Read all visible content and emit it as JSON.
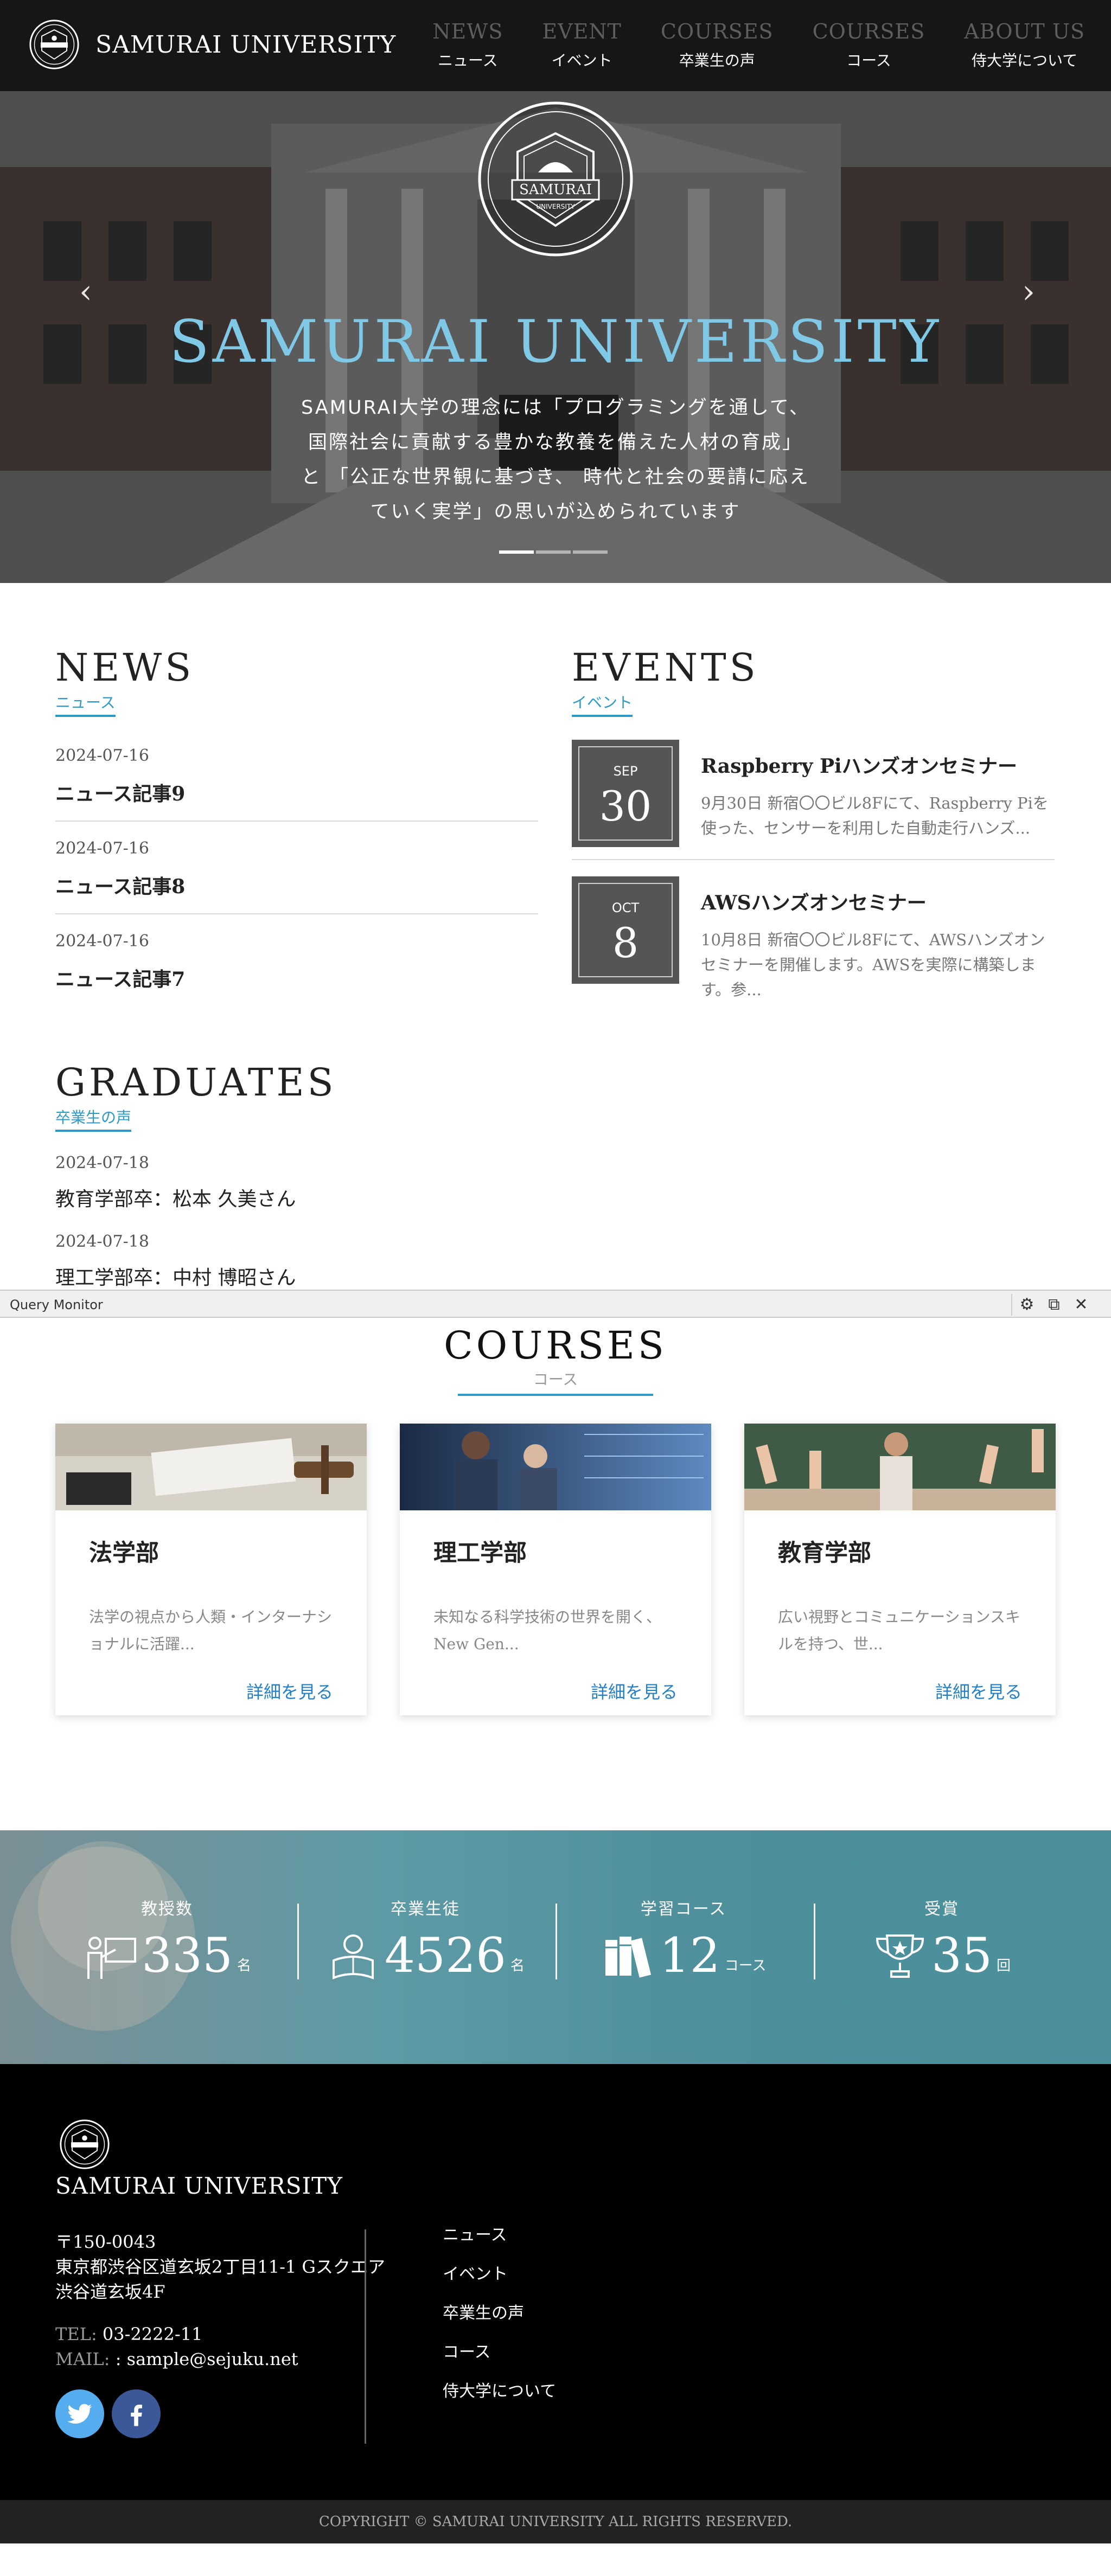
{
  "header": {
    "site_title": "SAMURAI UNIVERSITY",
    "emblem_text": "SAMURAI",
    "nav": [
      {
        "en": "NEWS",
        "ja": "ニュース"
      },
      {
        "en": "EVENT",
        "ja": "イベント"
      },
      {
        "en": "COURSES",
        "ja": "卒業生の声"
      },
      {
        "en": "COURSES",
        "ja": "コース"
      },
      {
        "en": "ABOUT US",
        "ja": "侍大学について"
      }
    ]
  },
  "hero": {
    "emblem_text": "SAMURAI",
    "emblem_sub": "UNIVERSITY",
    "title": "SAMURAI UNIVERSITY",
    "lines": [
      "SAMURAI大学の理念には「プログラミングを通して、",
      "国際社会に貢献する豊かな教養を備えた人材の育成」",
      "と 「公正な世界観に基づき、 時代と社会の要請に応え",
      "ていく実学」の思いが込められています"
    ],
    "prev_icon": "chevron-left-icon",
    "next_icon": "chevron-right-icon",
    "slides": 3,
    "active_slide": 0
  },
  "news": {
    "heading_en": "NEWS",
    "heading_ja": "ニュース",
    "items": [
      {
        "date": "2024-07-16",
        "title": "ニュース記事9"
      },
      {
        "date": "2024-07-16",
        "title": "ニュース記事8"
      },
      {
        "date": "2024-07-16",
        "title": "ニュース記事7"
      }
    ]
  },
  "events": {
    "heading_en": "EVENTS",
    "heading_ja": "イベント",
    "items": [
      {
        "month": "SEP",
        "day": "30",
        "title": "Raspberry Piハンズオンセミナー",
        "desc": "9月30日 新宿〇〇ビル8Fにて、Raspberry Piを使った、センサーを利用した自動走行ハンズ..."
      },
      {
        "month": "OCT",
        "day": "8",
        "title": "AWSハンズオンセミナー",
        "desc": "10月8日 新宿〇〇ビル8Fにて、AWSハンズオンセミナーを開催します。AWSを実際に構築します。参..."
      }
    ]
  },
  "graduates": {
    "heading_en": "GRADUATES",
    "heading_ja": "卒業生の声",
    "items": [
      {
        "date": "2024-07-18",
        "title": "教育学部卒：松本 久美さん"
      },
      {
        "date": "2024-07-18",
        "title": "理工学部卒：中村 博昭さん"
      }
    ]
  },
  "query_monitor": {
    "title": "Query Monitor",
    "icons": [
      "gear-icon",
      "popout-icon",
      "close-icon"
    ]
  },
  "courses": {
    "heading_en": "COURSES",
    "heading_ja": "コース",
    "more_label": "詳細を見る",
    "items": [
      {
        "title": "法学部",
        "desc": "法学の視点から人類・インターナショナルに活躍..."
      },
      {
        "title": "理工学部",
        "desc": "未知なる科学技術の世界を開く、New Gen..."
      },
      {
        "title": "教育学部",
        "desc": "広い視野とコミュニケーションスキルを持つ、世..."
      }
    ]
  },
  "stats": [
    {
      "label": "教授数",
      "value": "335",
      "unit": "名",
      "icon": "teacher-icon"
    },
    {
      "label": "卒業生徒",
      "value": "4526",
      "unit": "名",
      "icon": "student-reading-icon"
    },
    {
      "label": "学習コース",
      "value": "12",
      "unit": "コース",
      "icon": "books-icon"
    },
    {
      "label": "受賞",
      "value": "35",
      "unit": "回",
      "icon": "trophy-icon"
    }
  ],
  "footer": {
    "title": "SAMURAI UNIVERSITY",
    "postal": "〒150-0043",
    "address1": "東京都渋谷区道玄坂2丁目11-1 Gスクエア",
    "address2": "渋谷道玄坂4F",
    "tel_label": "TEL: ",
    "tel": "03-2222-11",
    "mail_label": "MAIL: ",
    "mail": ": sample@sejuku.net",
    "nav": [
      "ニュース",
      "イベント",
      "卒業生の声",
      "コース",
      "侍大学について"
    ],
    "social": [
      "twitter-icon",
      "facebook-icon"
    ],
    "twitter_color": "#55acee",
    "facebook_color": "#3b5998",
    "copyright": "COPYRIGHT © SAMURAI UNIVERSITY ALL RIGHTS RESERVED."
  },
  "colors": {
    "accent": "#2e9ac6",
    "link": "#2280c8",
    "hero_title": "#7fc9e6"
  }
}
